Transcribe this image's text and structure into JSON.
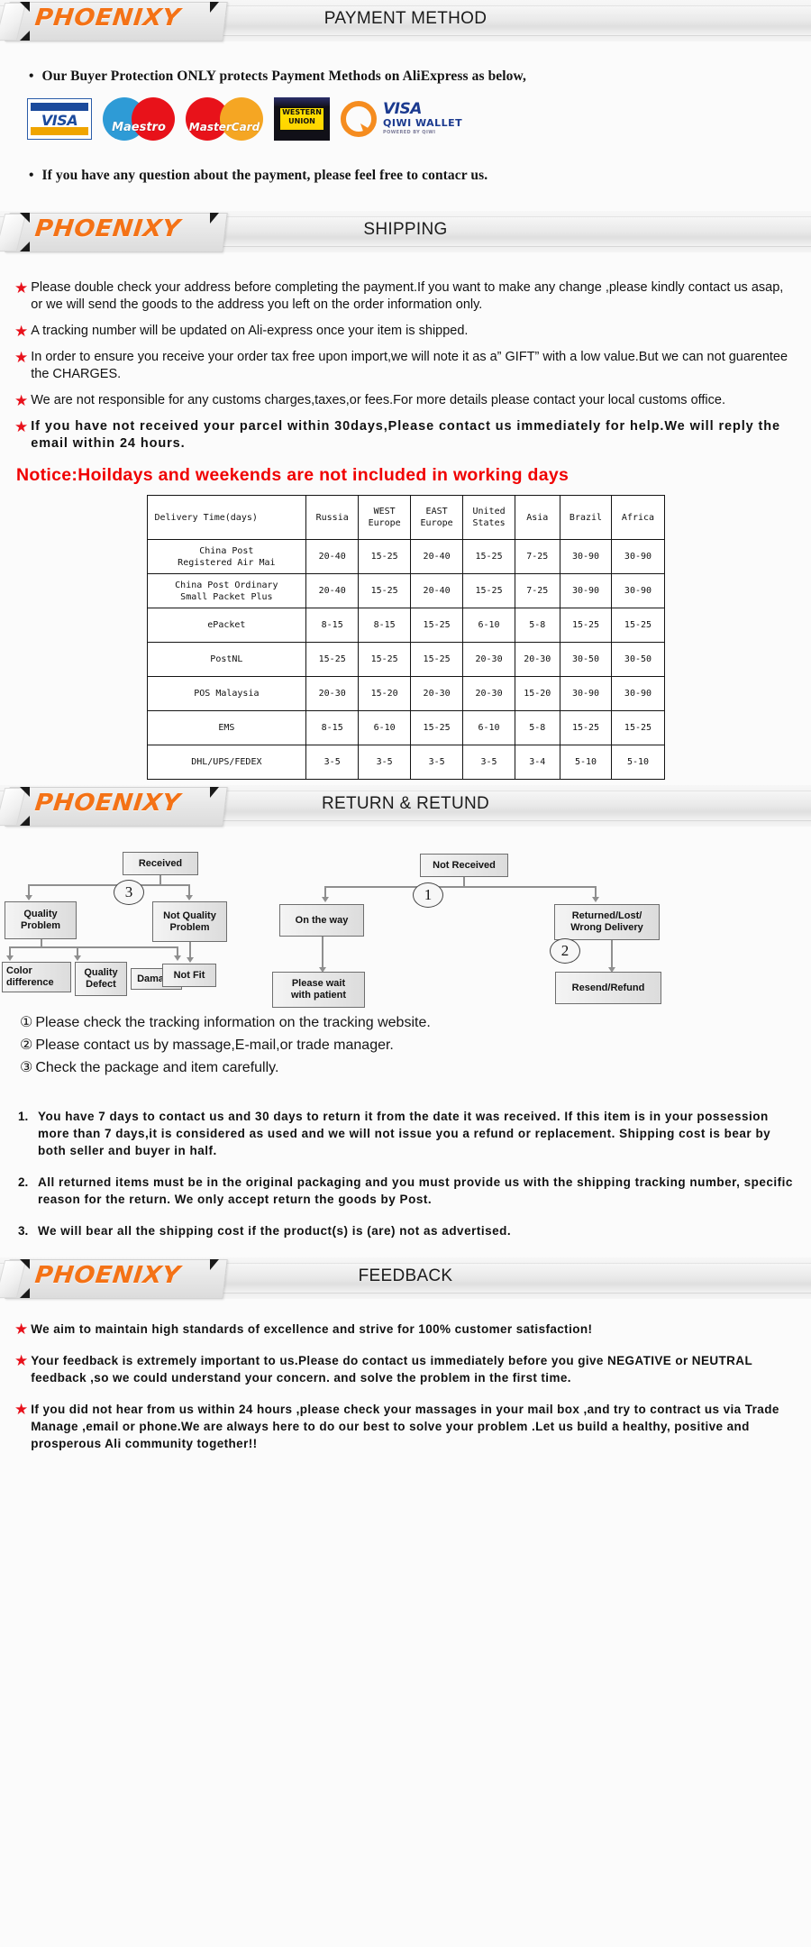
{
  "brand": "PHOENIXY",
  "sections": {
    "payment": {
      "title": "PAYMENT METHOD",
      "intro": "Our Buyer Protection ONLY protects Payment Methods on AliExpress as below,",
      "outro": "If you have any question about the payment, please feel free to contacr us.",
      "logos": [
        {
          "name": "visa-logo",
          "label": "VISA"
        },
        {
          "name": "maestro-logo",
          "label": "Maestro"
        },
        {
          "name": "mastercard-logo",
          "label": "MasterCard"
        },
        {
          "name": "western-union-logo",
          "label_line1": "WESTERN",
          "label_line2": "UNION"
        },
        {
          "name": "qiwi-visa-wallet-logo",
          "label1": "VISA",
          "label2": "QIWI WALLET",
          "label3": "POWERED BY QIWI"
        }
      ]
    },
    "shipping": {
      "title": "SHIPPING",
      "bullets": [
        "Please double check your address before completing the payment.If you want to make any change ,please kindly contact us asap, or we will send the goods to the address you left on the order information only.",
        "A tracking number will be updated on Ali-express once your item is shipped.",
        "In order to ensure you receive your order tax free upon import,we will note it as a” GIFT” with a low value.But we can not guarentee the CHARGES.",
        "We are not responsible for any customs charges,taxes,or fees.For more details please contact your local customs office.",
        "If you have not received your parcel within 30days,Please contact us immediately for help.We will reply the email within 24 hours."
      ],
      "notice": "Notice:Hoildays  and  weekends  are  not  included  in  working  days"
    },
    "returns": {
      "title": "RETURN & RETUND",
      "flow": {
        "received": "Received",
        "quality_problem": "Quality\nProblem",
        "not_quality_problem": "Not Quality\nProblem",
        "color_difference": "Color\ndifference",
        "quality_defect": "Quality\nDefect",
        "damage": "Damage",
        "not_fit": "Not Fit",
        "not_received": "Not  Received",
        "on_the_way": "On the way",
        "returned_lost_wrong": "Returned/Lost/\nWrong Delivery",
        "please_wait": "Please wait\nwith patient",
        "resend_refund": "Resend/Refund",
        "badge_1": "1",
        "badge_2": "2",
        "badge_3": "3"
      },
      "circled_list": [
        {
          "num": "①",
          "text": "Please check the tracking information on the tracking website."
        },
        {
          "num": "②",
          "text": "Please contact us by  massage,E-mail,or trade manager."
        },
        {
          "num": "③",
          "text": "Check the package and item carefully."
        }
      ],
      "policy": [
        {
          "num": "1.",
          "text": "You have 7 days to contact us and 30 days to return it from the date it was received. If this item is in your possession more than 7 days,it is considered as used and we will not issue you a refund or replacement. Shipping cost is bear by both seller and buyer in half."
        },
        {
          "num": "2.",
          "text": "All returned items must be in the original packaging and you must provide us with the shipping tracking number, specific reason for the return. We only accept return the goods by Post."
        },
        {
          "num": "3.",
          "text": "We will bear all the shipping cost if the product(s) is (are) not as advertised."
        }
      ]
    },
    "feedback": {
      "title": "FEEDBACK",
      "bullets": [
        "We aim to maintain high standards of excellence and strive  for 100% customer satisfaction!",
        "Your feedback is extremely important to us.Please do contact us immediately before you give NEGATIVE or NEUTRAL feedback ,so  we could understand your concern. and solve the problem in the first time.",
        "If you did not hear from us within 24 hours ,please check your massages in your mail box ,and try to contract us via Trade Manage ,email or phone.We are always here to do our best to solve your problem .Let us build a healthy, positive and prosperous Ali community together!!"
      ]
    }
  },
  "chart_data": {
    "type": "table",
    "title": "Delivery Time(days)",
    "columns": [
      "Delivery Time(days)",
      "Russia",
      "WEST Europe",
      "EAST Europe",
      "United States",
      "Asia",
      "Brazil",
      "Africa"
    ],
    "column_lines": [
      [
        "Delivery Time(days)"
      ],
      [
        "Russia"
      ],
      [
        "WEST",
        "Europe"
      ],
      [
        "EAST",
        "Europe"
      ],
      [
        "United",
        "States"
      ],
      [
        "Asia"
      ],
      [
        "Brazil"
      ],
      [
        "Africa"
      ]
    ],
    "rows": [
      {
        "service_lines": [
          "China Post",
          "Registered Air Mai"
        ],
        "values": [
          "20-40",
          "15-25",
          "20-40",
          "15-25",
          "7-25",
          "30-90",
          "30-90"
        ]
      },
      {
        "service_lines": [
          "China Post Ordinary",
          "Small Packet Plus"
        ],
        "values": [
          "20-40",
          "15-25",
          "20-40",
          "15-25",
          "7-25",
          "30-90",
          "30-90"
        ]
      },
      {
        "service_lines": [
          "ePacket"
        ],
        "values": [
          "8-15",
          "8-15",
          "15-25",
          "6-10",
          "5-8",
          "15-25",
          "15-25"
        ]
      },
      {
        "service_lines": [
          "PostNL"
        ],
        "values": [
          "15-25",
          "15-25",
          "15-25",
          "20-30",
          "20-30",
          "30-50",
          "30-50"
        ]
      },
      {
        "service_lines": [
          "POS Malaysia"
        ],
        "values": [
          "20-30",
          "15-20",
          "20-30",
          "20-30",
          "15-20",
          "30-90",
          "30-90"
        ]
      },
      {
        "service_lines": [
          "EMS"
        ],
        "values": [
          "8-15",
          "6-10",
          "15-25",
          "6-10",
          "5-8",
          "15-25",
          "15-25"
        ]
      },
      {
        "service_lines": [
          "DHL/UPS/FEDEX"
        ],
        "values": [
          "3-5",
          "3-5",
          "3-5",
          "3-5",
          "3-4",
          "5-10",
          "5-10"
        ]
      }
    ]
  },
  "colors": {
    "brand_orange": "#f47216",
    "star_red": "#e8111b",
    "notice_red": "#f00000"
  }
}
